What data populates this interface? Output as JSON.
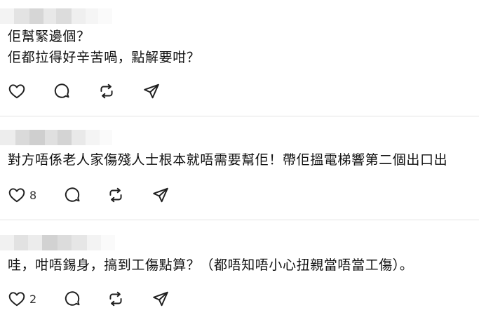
{
  "posts": [
    {
      "lines": [
        "佢幫緊邊個？",
        "佢都拉得好辛苦喎，點解要咁？"
      ],
      "like_count": "",
      "icons": [
        "heart-icon",
        "comment-icon",
        "repost-icon",
        "share-icon"
      ]
    },
    {
      "lines": [
        "對方唔係老人家傷殘人士根本就唔需要幫佢！帶佢搵電梯響第二個出口出"
      ],
      "like_count": "8",
      "icons": [
        "heart-icon",
        "comment-icon",
        "repost-icon",
        "share-icon"
      ]
    },
    {
      "lines": [
        "哇，咁唔錫身，搞到工傷點算？（都唔知唔小心扭親當唔當工傷）。"
      ],
      "like_count": "2",
      "icons": [
        "heart-icon",
        "comment-icon",
        "repost-icon",
        "share-icon"
      ]
    }
  ]
}
